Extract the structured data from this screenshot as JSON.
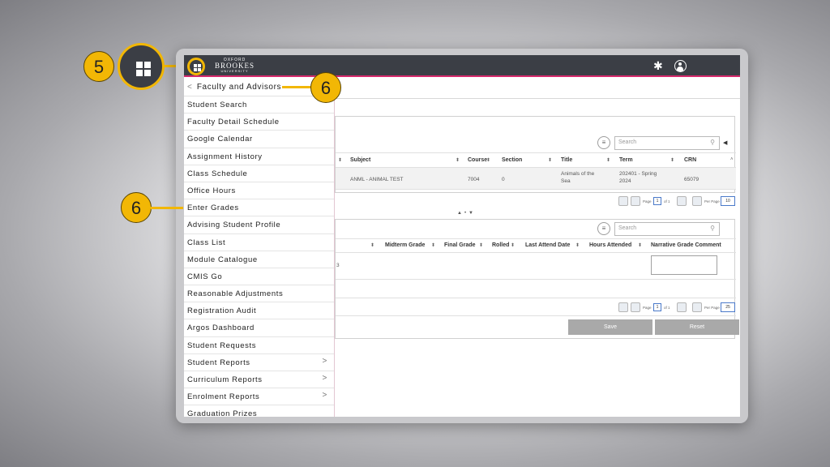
{
  "app": {
    "logo": {
      "line1": "OXFORD",
      "line2": "BROOKES",
      "line3": "UNIVERSITY"
    },
    "icons": {
      "apps": "grid-icon",
      "settings": "gear-icon",
      "user": "user-icon"
    },
    "accent_color": "#d6296d",
    "callout_color": "#f2b705"
  },
  "menu": {
    "header": "Faculty and Advisors",
    "items": [
      {
        "label": "Student Search"
      },
      {
        "label": "Faculty Detail Schedule"
      },
      {
        "label": "Google Calendar"
      },
      {
        "label": "Assignment History"
      },
      {
        "label": "Class Schedule"
      },
      {
        "label": "Office Hours"
      },
      {
        "label": "Enter Grades"
      },
      {
        "label": "Advising Student Profile"
      },
      {
        "label": "Class List"
      },
      {
        "label": "Module Catalogue"
      },
      {
        "label": "CMIS Go"
      },
      {
        "label": "Reasonable Adjustments"
      },
      {
        "label": "Registration Audit"
      },
      {
        "label": "Argos Dashboard"
      },
      {
        "label": "Student Requests"
      },
      {
        "label": "Student Reports",
        "submenu": true
      },
      {
        "label": "Curriculum Reports",
        "submenu": true
      },
      {
        "label": "Enrolment Reports",
        "submenu": true
      },
      {
        "label": "Graduation Prizes"
      }
    ]
  },
  "courses_table": {
    "search_placeholder": "Search",
    "columns": [
      "Subject",
      "Course",
      "Section",
      "Title",
      "Term",
      "CRN"
    ],
    "rows": [
      {
        "subject": "ANML - ANIMAL TEST",
        "course": "7004",
        "section": "0",
        "title": "Animals of the Sea",
        "term": "202401 - Spring 2024",
        "crn": "65079"
      }
    ],
    "pager": {
      "page_label": "Page",
      "page": "1",
      "of": "of 1",
      "per_page_label": "Per Page",
      "per_page": "10"
    }
  },
  "grades_table": {
    "search_placeholder": "Search",
    "columns": [
      "Midterm Grade",
      "Final Grade",
      "Rolled",
      "Last Attend Date",
      "Hours Attended",
      "Narrative Grade Comment"
    ],
    "row_fragment": "3",
    "pager": {
      "page_label": "Page",
      "page": "1",
      "of": "of 1",
      "per_page_label": "Per Page",
      "per_page": "25"
    },
    "save_label": "Save",
    "reset_label": "Reset"
  },
  "callouts": {
    "step5": "5",
    "step6_header": "6",
    "step6_item": "6"
  }
}
